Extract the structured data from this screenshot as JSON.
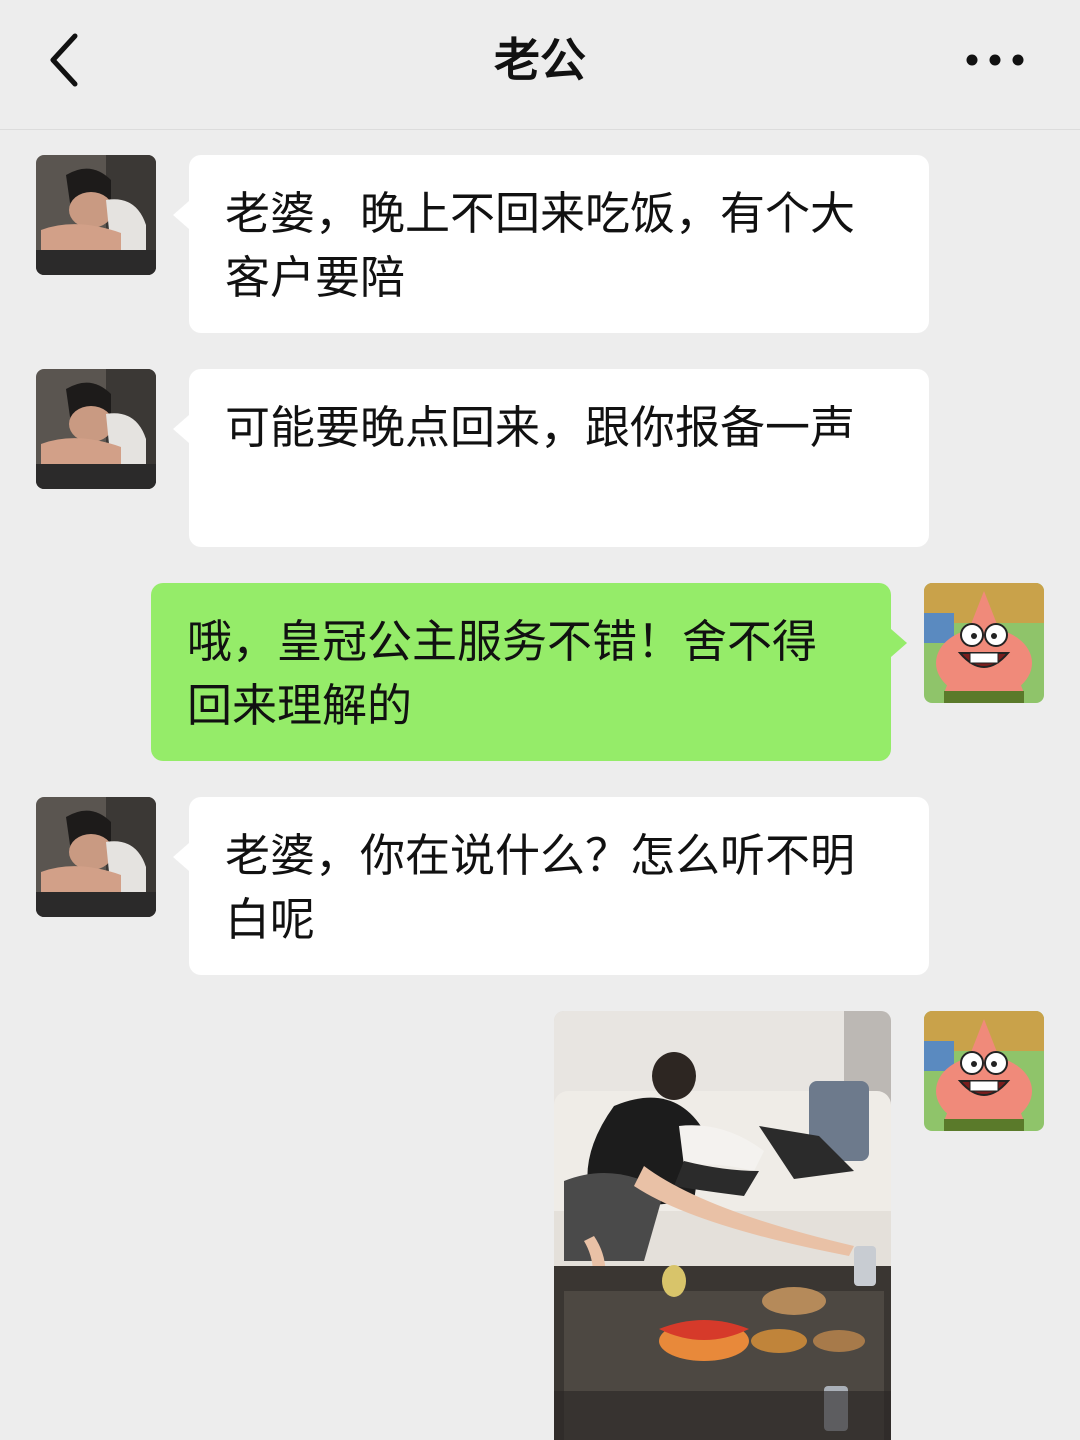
{
  "header": {
    "title": "老公",
    "back_icon": "chevron-left-icon",
    "more_icon": "more-dots-icon"
  },
  "colors": {
    "background": "#ededed",
    "incoming_bubble": "#ffffff",
    "outgoing_bubble": "#95ec69"
  },
  "messages": [
    {
      "sender": "husband",
      "text": "老婆，晚上不回来吃饭，有个大客户要陪"
    },
    {
      "sender": "husband",
      "text": "可能要晚点回来，跟你报备一声"
    },
    {
      "sender": "me",
      "text": "哦，皇冠公主服务不错！舍不得回来理解的"
    },
    {
      "sender": "husband",
      "text": "老婆，你在说什么？怎么听不明白呢"
    },
    {
      "sender": "me",
      "type": "image"
    }
  ]
}
